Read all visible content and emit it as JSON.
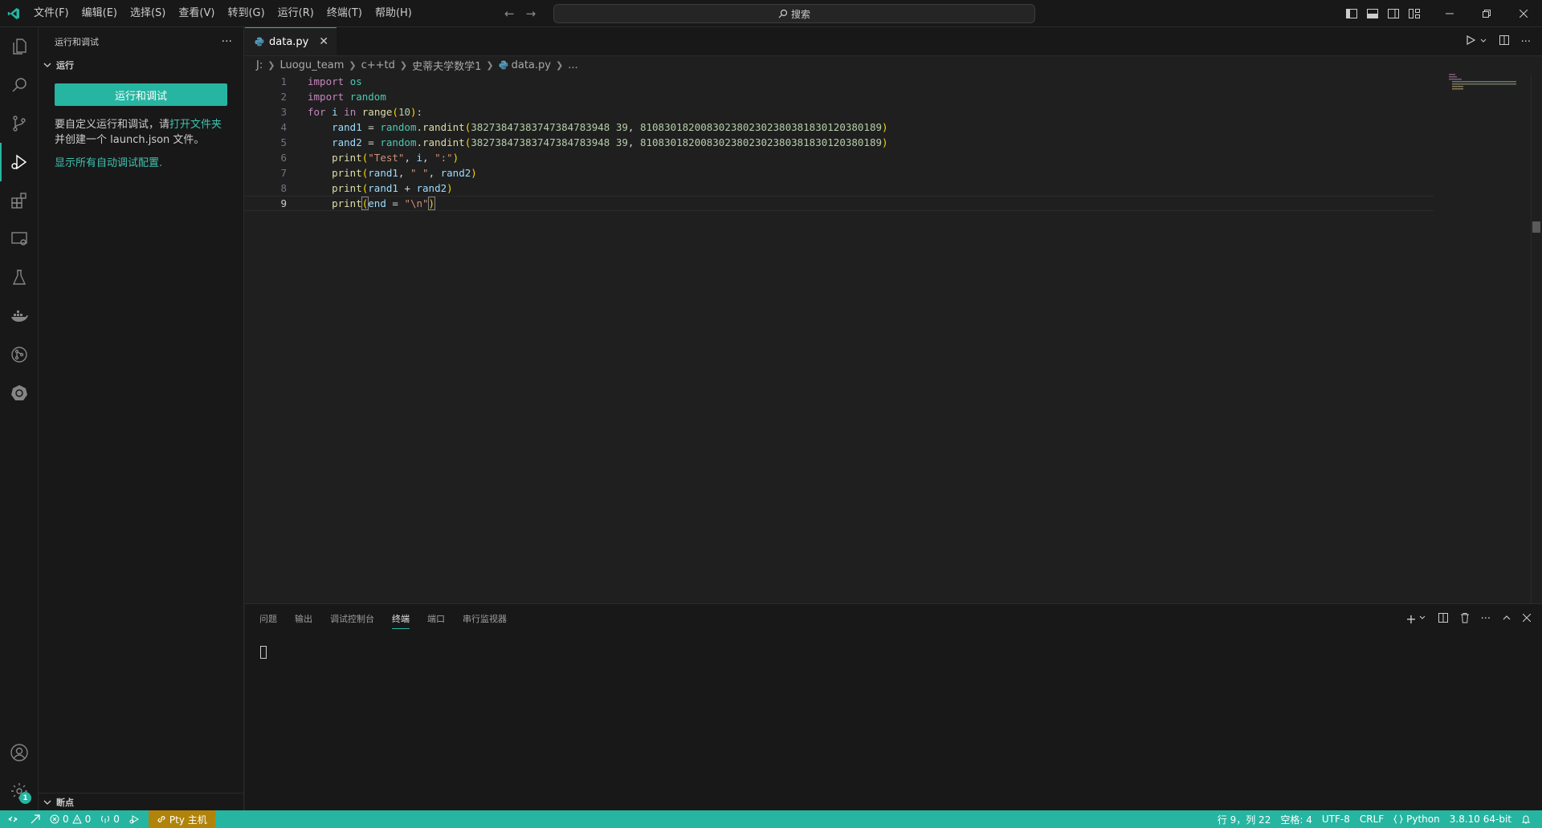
{
  "titlebar": {
    "menus": [
      "文件(F)",
      "编辑(E)",
      "选择(S)",
      "查看(V)",
      "转到(G)",
      "运行(R)",
      "终端(T)",
      "帮助(H)"
    ],
    "search_label": "搜索"
  },
  "activitybar": {
    "items": [
      "explorer-icon",
      "search-icon",
      "source-control-icon",
      "run-debug-icon",
      "extensions-icon",
      "remote-explorer-icon",
      "testing-icon",
      "docker-icon",
      "git-graph-icon",
      "kubernetes-icon"
    ],
    "settings_badge": "1"
  },
  "sidebar": {
    "title": "运行和调试",
    "more": "···",
    "section_run": "运行",
    "run_button": "运行和调试",
    "hint_part1": "要自定义运行和调试，请",
    "hint_link": "打开文件夹",
    "hint_part2": "并创建一个 launch.json 文件。",
    "show_all_link": "显示所有自动调试配置.",
    "section_breakpoints": "断点"
  },
  "editor": {
    "tab_label": "data.py",
    "breadcrumb": [
      "J:",
      "Luogu_team",
      "c++td",
      "史蒂夫学数学1",
      "data.py",
      "..."
    ],
    "line_numbers": [
      "1",
      "2",
      "3",
      "4",
      "5",
      "6",
      "7",
      "8",
      "9"
    ],
    "code": {
      "l1_kw": "import",
      "l1_mod": "os",
      "l2_kw": "import",
      "l2_mod": "random",
      "l3_for": "for",
      "l3_var": "i",
      "l3_in": "in",
      "l3_fn": "range",
      "l3_num": "10",
      "l3_end": "):",
      "l4_var": "rand1",
      "l4_eq": " = ",
      "l4_mod": "random",
      "l4_fn": ".randint",
      "l4_a": "38273847383747384783948 39",
      "l4_sep": ", ",
      "l4_b": "8108301820083023802302380381830120380189",
      "l5_var": "rand2",
      "l5_eq": " = ",
      "l5_mod": "random",
      "l5_fn": ".randint",
      "l5_a": "38273847383747384783948 39",
      "l5_sep": ", ",
      "l5_b": "8108301820083023802302380381830120380189",
      "l6_fn": "print",
      "l6_s": "\"Test\"",
      "l6_c1": ", ",
      "l6_v": "i",
      "l6_c2": ", ",
      "l6_s2": "\":\"",
      "l7_fn": "print",
      "l7_v1": "rand1",
      "l7_c1": ", ",
      "l7_s": "\" \"",
      "l7_c2": ", ",
      "l7_v2": "rand2",
      "l8_fn": "print",
      "l8_v1": "rand1",
      "l8_op": " + ",
      "l8_v2": "rand2",
      "l9_fn": "print",
      "l9_v": "end",
      "l9_eq": " = ",
      "l9_s": "\"\\n\""
    }
  },
  "panel": {
    "tabs": [
      "问题",
      "输出",
      "调试控制台",
      "终端",
      "端口",
      "串行监视器"
    ],
    "active_tab": "终端"
  },
  "statusbar": {
    "errors": "0",
    "warnings": "0",
    "ports": "0",
    "pty": "Pty 主机",
    "position": "行 9，列 22",
    "spaces": "空格: 4",
    "encoding": "UTF-8",
    "eol": "CRLF",
    "language": "Python",
    "interpreter": "3.8.10 64-bit"
  },
  "colors": {
    "accent": "#26b5a1",
    "pty_bg": "#b0830a"
  }
}
